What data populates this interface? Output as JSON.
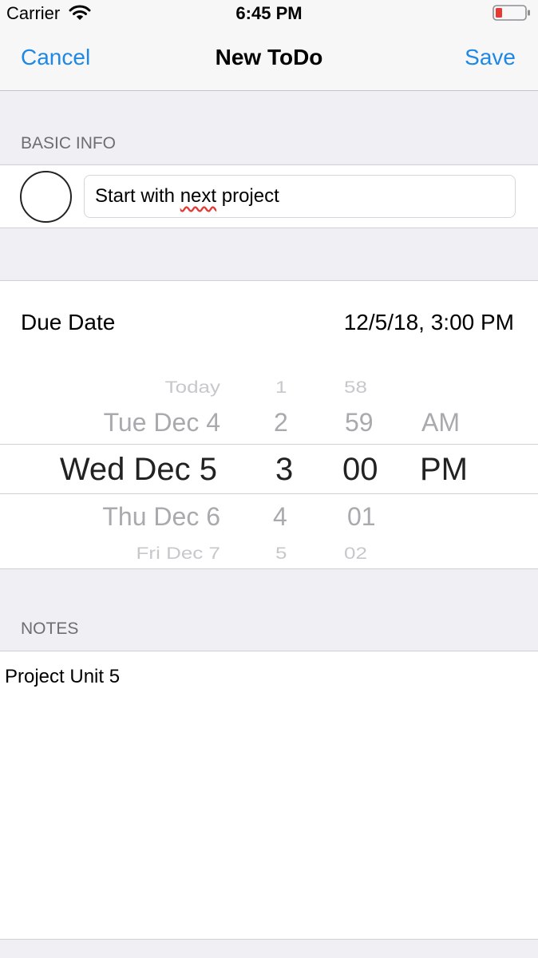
{
  "status_bar": {
    "carrier": "Carrier",
    "time": "6:45 PM",
    "battery_color": "#e53935"
  },
  "nav": {
    "cancel_label": "Cancel",
    "title": "New ToDo",
    "save_label": "Save",
    "accent_color": "#1e88e5"
  },
  "basic_info": {
    "header": "BASIC INFO",
    "title_value_pre": "Start with ",
    "title_value_flagged": "next",
    "title_value_post": " project"
  },
  "due_date": {
    "label": "Due Date",
    "value": "12/5/18, 3:00 PM"
  },
  "picker": {
    "day_column": [
      "Today",
      "Tue Dec 4",
      "Wed Dec 5",
      "Thu Dec 6",
      "Fri Dec 7"
    ],
    "hour_column": [
      "1",
      "2",
      "3",
      "4",
      "5"
    ],
    "minute_column": [
      "58",
      "59",
      "00",
      "01",
      "02"
    ],
    "ampm_column": [
      "AM",
      "PM"
    ],
    "selected": {
      "day": "Wed Dec 5",
      "hour": "3",
      "minute": "00",
      "ampm": "PM"
    }
  },
  "notes": {
    "header": "NOTES",
    "text": "Project Unit 5"
  }
}
